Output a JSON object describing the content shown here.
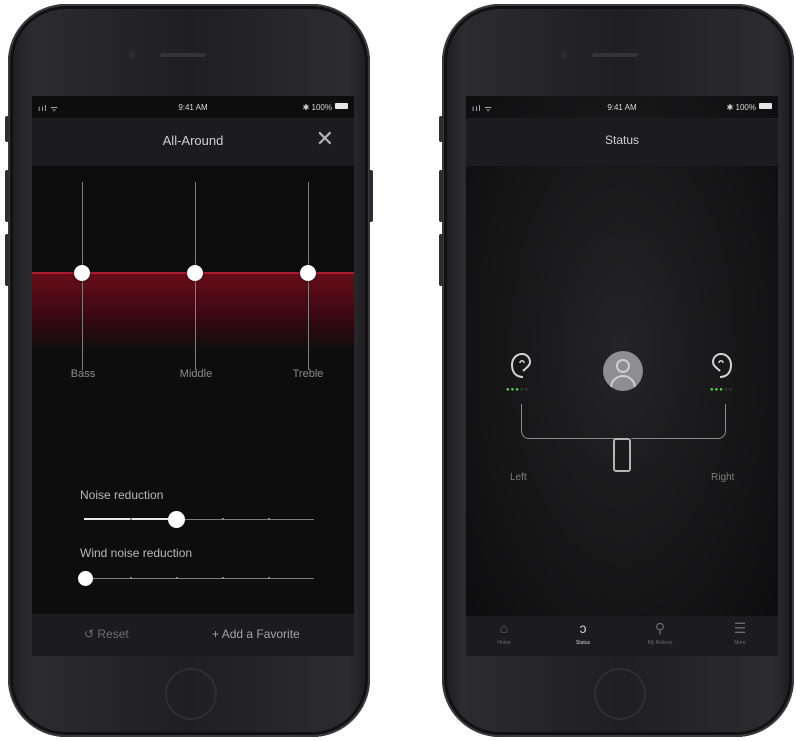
{
  "status_bar": {
    "signal": "ııl ᯤ",
    "time": "9:41 AM",
    "battery": "✱ 100%"
  },
  "equalizer_screen": {
    "title": "All-Around",
    "close_icon": "close-icon",
    "bands": [
      {
        "label": "Bass"
      },
      {
        "label": "Middle"
      },
      {
        "label": "Treble"
      }
    ],
    "noise_reduction": {
      "label": "Noise reduction",
      "value_fraction": 0.4
    },
    "wind_noise_reduction": {
      "label": "Wind noise reduction",
      "value_fraction": 0.0
    },
    "reset_label": "Reset",
    "add_favorite_label": "Add a Favorite",
    "accent_color": "#8b1526"
  },
  "status_screen": {
    "title": "Status",
    "left": {
      "label": "Left",
      "battery_dots_on": 3,
      "battery_dots_total": 5
    },
    "right": {
      "label": "Right",
      "battery_dots_on": 3,
      "battery_dots_total": 5
    },
    "tabs": [
      {
        "label": "Home",
        "icon": "home-icon"
      },
      {
        "label": "Status",
        "icon": "ear-icon"
      },
      {
        "label": "My Relieve",
        "icon": "person-icon"
      },
      {
        "label": "More",
        "icon": "menu-icon"
      }
    ],
    "battery_color": "#5fd35a"
  }
}
